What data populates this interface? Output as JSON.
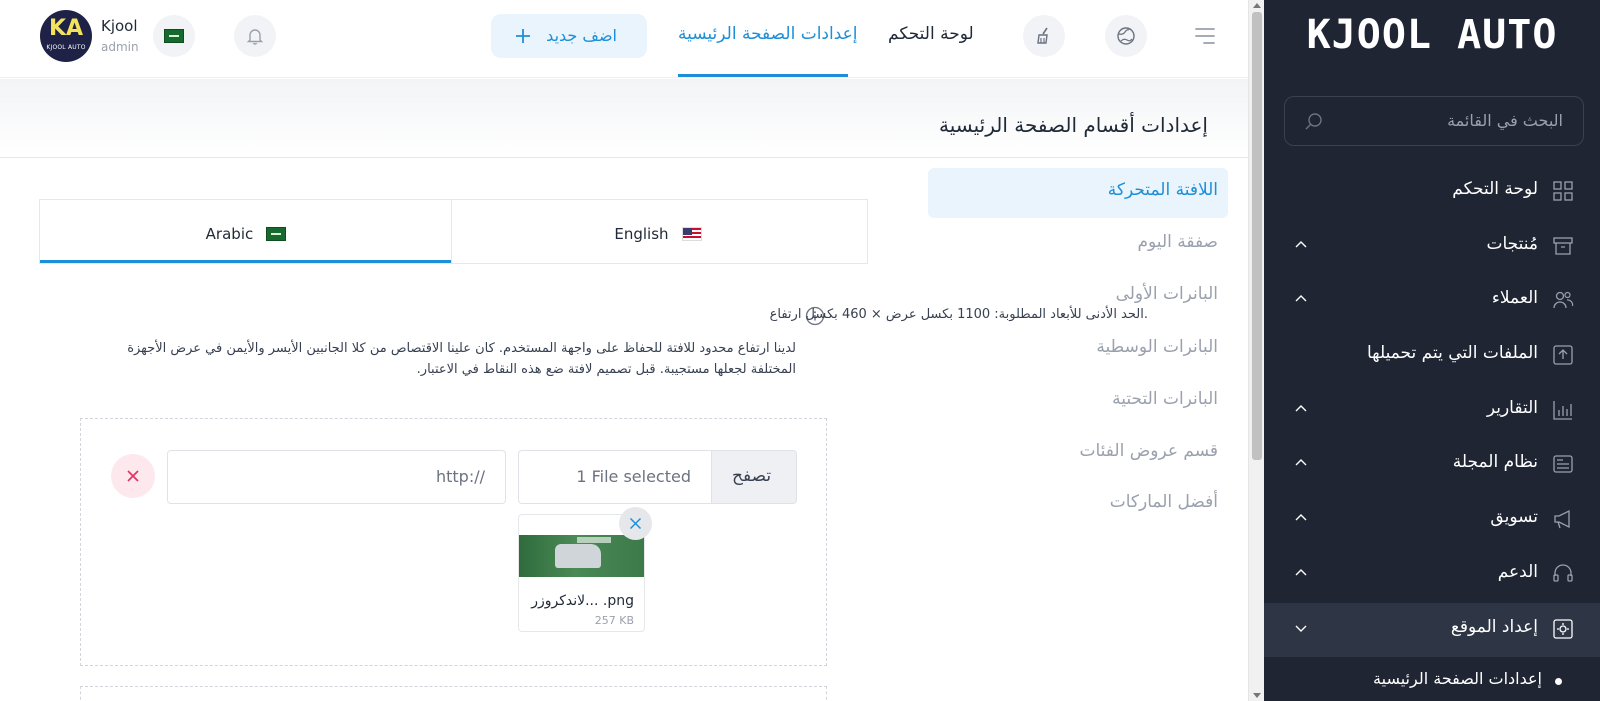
{
  "sidebar": {
    "brand": "KJOOL AUTO",
    "search_placeholder": "البحث في القائمة",
    "items": [
      {
        "label": "لوحة التحكم"
      },
      {
        "label": "مُنتجات"
      },
      {
        "label": "العملاء"
      },
      {
        "label": "الملفات التي يتم تحميلها"
      },
      {
        "label": "التقارير"
      },
      {
        "label": "نظام المجلة"
      },
      {
        "label": "تسويق"
      },
      {
        "label": "الدعم"
      },
      {
        "label": "إعداد الموقع"
      }
    ],
    "sub_item": "إعدادات الصفحة الرئيسية"
  },
  "topbar": {
    "user_name": "Kjool",
    "user_role": "admin",
    "avatar_initials": "KA",
    "avatar_sub": "KJOOL AUTO",
    "add_new": "اضف جديد",
    "tabs": [
      "لوحة التحكم",
      "إعدادات الصفحة الرئيسية"
    ]
  },
  "page": {
    "title": "إعدادات أقسام الصفحة الرئيسية"
  },
  "sections": [
    "اللافتة المتحركة",
    "صفقة اليوم",
    "البانرات الأولى",
    "البانرات الوسطية",
    "البانرات التحتية",
    "قسم عروض الفئات",
    "أفضل الماركات"
  ],
  "languages": {
    "english": "English",
    "arabic": "Arabic"
  },
  "info": {
    "line1": "الحد الأدنى للأبعاد المطلوبة: 1100 بكسل عرض × 460 بكسل ارتفاع.",
    "line2": "لدينا ارتفاع محدود للافتة للحفاظ على واجهة المستخدم. كان علينا الاقتصاص من كلا الجانبين الأيسر والأيمن في عرض الأجهزة المختلفة لجعلها مستجيبة. قبل تصميم لافتة ضع هذه النقاط في الاعتبار."
  },
  "upload": {
    "browse": "تصفح",
    "file_selected": "1 File selected",
    "url_placeholder": "http://",
    "file_name": "لاندكروزر... .png",
    "file_size": "257 KB"
  },
  "icons": {
    "menu": "hamburger-icon",
    "globe": "globe-icon",
    "clean": "broom-icon",
    "bell": "bell-icon"
  },
  "colors": {
    "accent": "#1d8fd8",
    "sidebar_bg": "#1f2532",
    "danger": "#e0325f"
  }
}
